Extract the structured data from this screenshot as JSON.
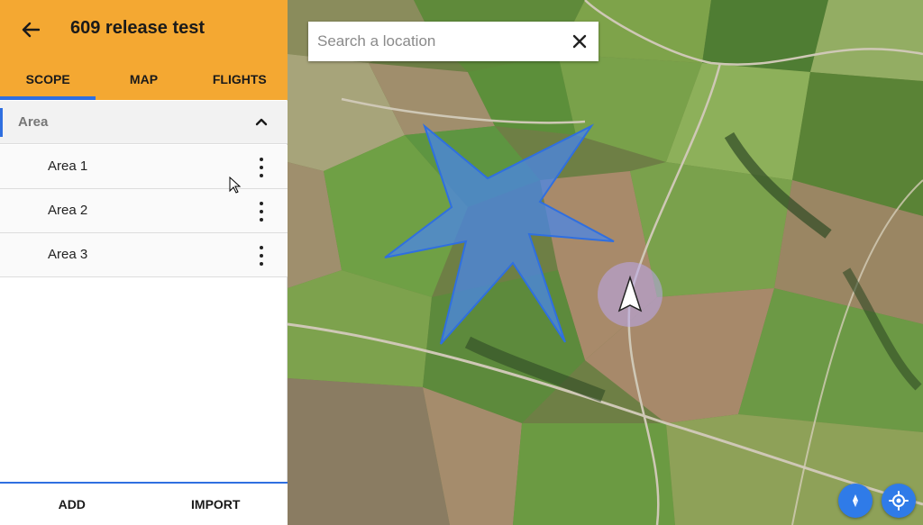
{
  "appbar": {
    "title": "609 release test",
    "back_icon": "arrow-left-icon"
  },
  "tabs": [
    {
      "label": "SCOPE",
      "active": true
    },
    {
      "label": "MAP",
      "active": false
    },
    {
      "label": "FLIGHTS",
      "active": false
    }
  ],
  "section": {
    "label": "Area",
    "collapse_icon": "chevron-up-icon"
  },
  "areas": [
    {
      "label": "Area 1"
    },
    {
      "label": "Area 2"
    },
    {
      "label": "Area 3"
    }
  ],
  "bottom": {
    "add_label": "ADD",
    "import_label": "IMPORT"
  },
  "search": {
    "placeholder": "Search a location",
    "value": ""
  },
  "map_controls": {
    "compass_icon": "compass-icon",
    "locate_icon": "my-location-icon"
  },
  "colors": {
    "accent": "#f4a832",
    "primary": "#2f6fe0",
    "polygon_fill": "#4a86e8"
  }
}
